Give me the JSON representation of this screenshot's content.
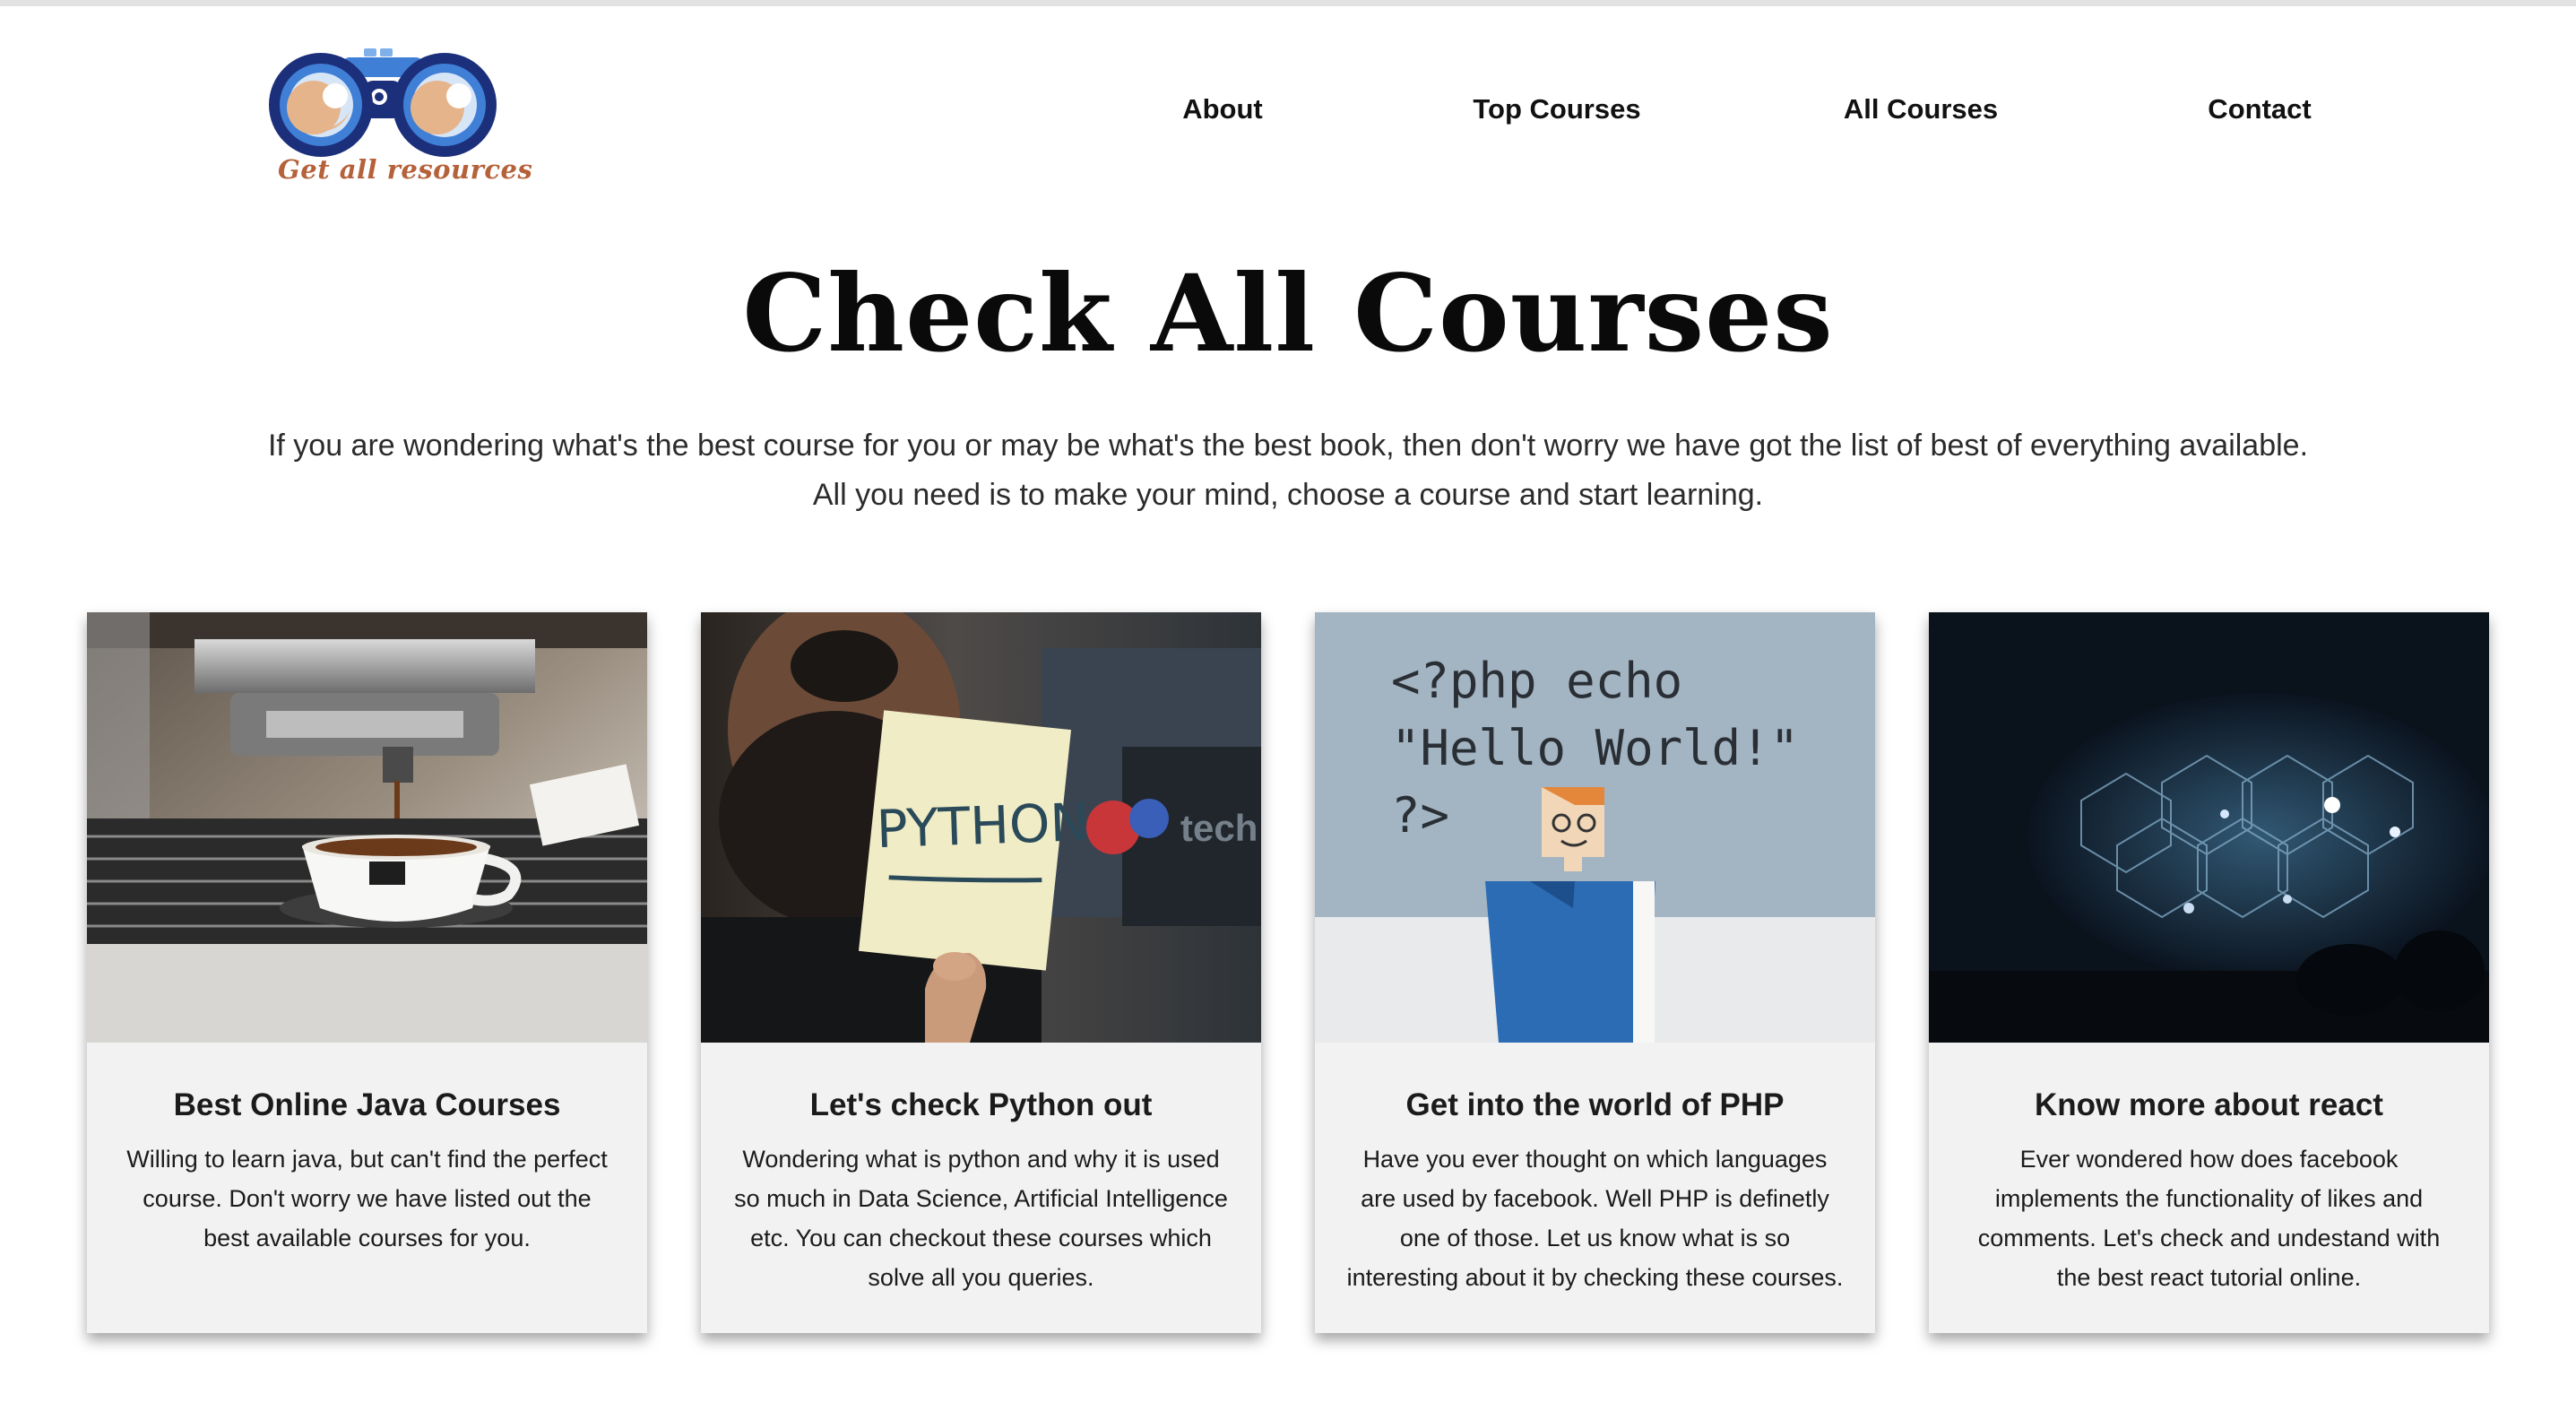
{
  "brand": {
    "logo_icon": "binoculars-icon",
    "tagline": "Get all resources",
    "colors": {
      "navy": "#1c2f7a",
      "blue": "#3f7fd6",
      "lens": "#e6b48a",
      "tagline": "#b5613a"
    }
  },
  "nav": {
    "items": [
      {
        "label": "About"
      },
      {
        "label": "Top Courses"
      },
      {
        "label": "All Courses"
      },
      {
        "label": "Contact"
      }
    ]
  },
  "hero": {
    "title": "Check All Courses",
    "intro_line1": "If you are wondering what's the best course for you or may be what's the best book, then don't worry we have got the list of best of everything available.",
    "intro_line2": "All you need is to make your mind, choose a course and start learning."
  },
  "cards": [
    {
      "image": "espresso-machine-photo",
      "title": "Best Online Java Courses",
      "description": "Willing to learn java, but can't find the perfect course. Don't worry we have listed out the best available courses for you."
    },
    {
      "image": "python-sticky-note-photo",
      "image_text": "PYTHON",
      "title": "Let's check Python out",
      "description": "Wondering what is python and why it is used so much in Data Science, Artificial Intelligence etc. You can checkout these courses which solve all you queries."
    },
    {
      "image": "php-hello-world-figure-photo",
      "image_text_1": "<?php echo",
      "image_text_2": "\"Hello World!\"",
      "image_text_3": "?>",
      "title": "Get into the world of PHP",
      "description": "Have you ever thought on which languages are used by facebook. Well PHP is definetly one of those. Let us know what is so interesting about it by checking these courses."
    },
    {
      "image": "dark-concert-stage-photo",
      "title": "Know more about react",
      "description": "Ever wondered how does facebook implements the functionality of likes and comments. Let's check and undestand with the best react tutorial online."
    }
  ]
}
